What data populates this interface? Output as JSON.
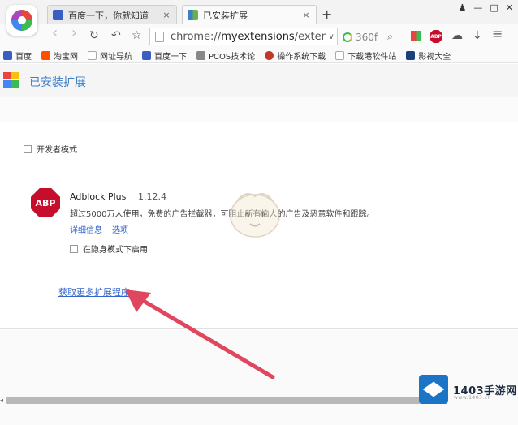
{
  "tabs": [
    {
      "title": "百度一下，你就知道",
      "close": "×"
    },
    {
      "title": "已安装扩展",
      "close": "×"
    }
  ],
  "new_tab": "+",
  "window_controls": {
    "skin": "♟",
    "minimize": "—",
    "maximize": "□",
    "close": "✕"
  },
  "toolbar": {
    "back": "‹",
    "forward": "›",
    "reload": "↻",
    "undo": "↶",
    "star": "☆",
    "url_prefix": "chrome://",
    "url_host": "myextensions",
    "url_suffix": "/extensio",
    "dropdown": "∨",
    "search_label": "360f",
    "search_icon": "⌕",
    "abp_badge": "ABP",
    "cloud": "☁",
    "download": "↓",
    "menu": "≡"
  },
  "bookmarks": [
    {
      "label": "百度",
      "icon": "paw-icon",
      "color": "#3b5fc0"
    },
    {
      "label": "淘宝网",
      "icon": "taobao-icon",
      "color": "#ff5000"
    },
    {
      "label": "网址导航",
      "icon": "page-icon",
      "color": "#cccccc"
    },
    {
      "label": "百度一下",
      "icon": "paw-icon",
      "color": "#3b5fc0"
    },
    {
      "label": "PCOS技术论",
      "icon": "pcos-icon",
      "color": "#888888"
    },
    {
      "label": "操作系统下载",
      "icon": "os-icon",
      "color": "#c0392b"
    },
    {
      "label": "下载港软件站",
      "icon": "page-icon",
      "color": "#cccccc"
    },
    {
      "label": "影视大全",
      "icon": "video-icon",
      "color": "#1d3f7a"
    }
  ],
  "page": {
    "title": "已安装扩展"
  },
  "developer_mode": {
    "label": "开发者模式",
    "checked": false
  },
  "extension": {
    "icon_text": "ABP",
    "name": "Adblock Plus",
    "version": "1.12.4",
    "description": "超过5000万人使用，免费的广告拦截器，可阻止所有恼人的广告及恶意软件和跟踪。",
    "details_link": "详细信息",
    "options_link": "选项",
    "incognito_label": "在隐身模式下启用",
    "incognito_checked": false
  },
  "get_more_link": "获取更多扩展程序",
  "brand": {
    "name": "1403手游网",
    "url": "www.1403.cn"
  },
  "colors": {
    "link": "#3366cc",
    "title": "#3b7fc9",
    "abp_red": "#c70d2c",
    "arrow": "#e0475e",
    "brand_blue": "#1c74c6"
  }
}
